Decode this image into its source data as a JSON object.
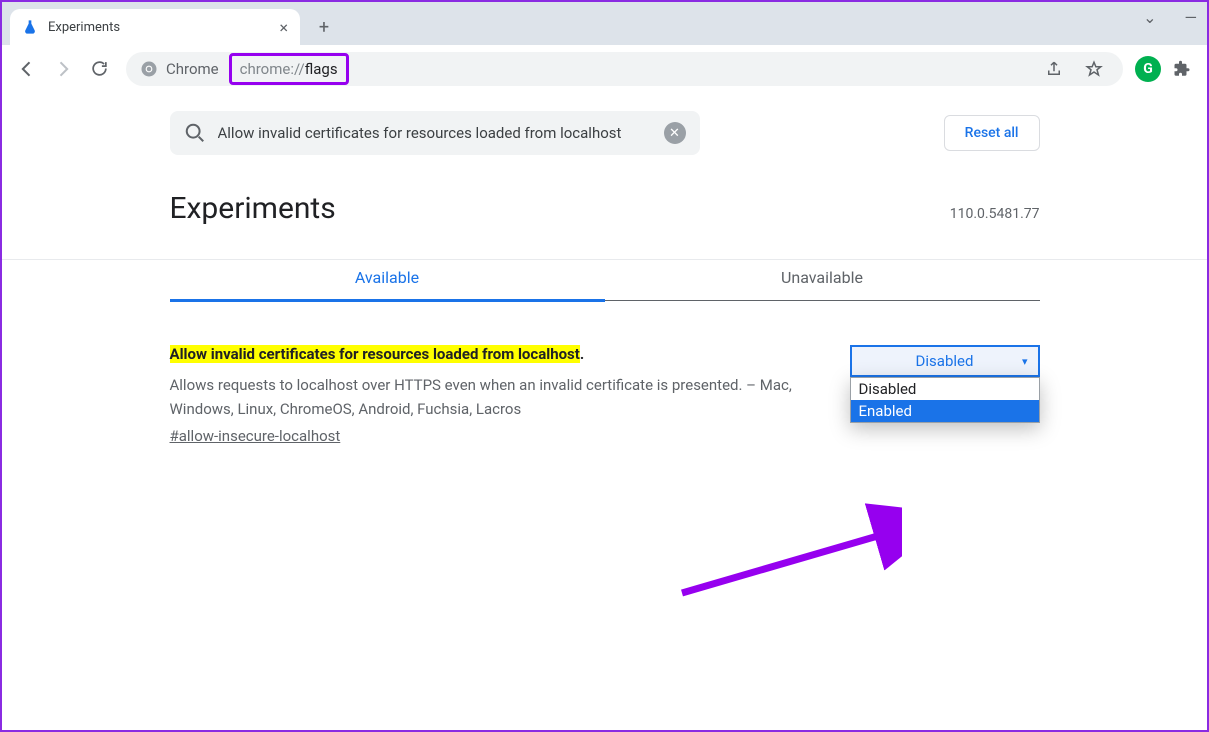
{
  "tab": {
    "title": "Experiments"
  },
  "omnibox": {
    "chip": "Chrome",
    "url_prefix": "chrome://",
    "url_path": "flags"
  },
  "window_controls": {
    "dropdown": "⌄",
    "minimize": "—"
  },
  "search": {
    "value": "Allow invalid certificates for resources loaded from localhost"
  },
  "reset_label": "Reset all",
  "page_title": "Experiments",
  "version": "110.0.5481.77",
  "tabs": {
    "available": "Available",
    "unavailable": "Unavailable"
  },
  "flag": {
    "title": "Allow invalid certificates for resources loaded from localhost",
    "title_suffix": ".",
    "description": "Allows requests to localhost over HTTPS even when an invalid certificate is presented. – Mac, Windows, Linux, ChromeOS, Android, Fuchsia, Lacros",
    "link": "#allow-insecure-localhost",
    "selected": "Disabled",
    "options": {
      "0": "Disabled",
      "1": "Enabled"
    }
  }
}
